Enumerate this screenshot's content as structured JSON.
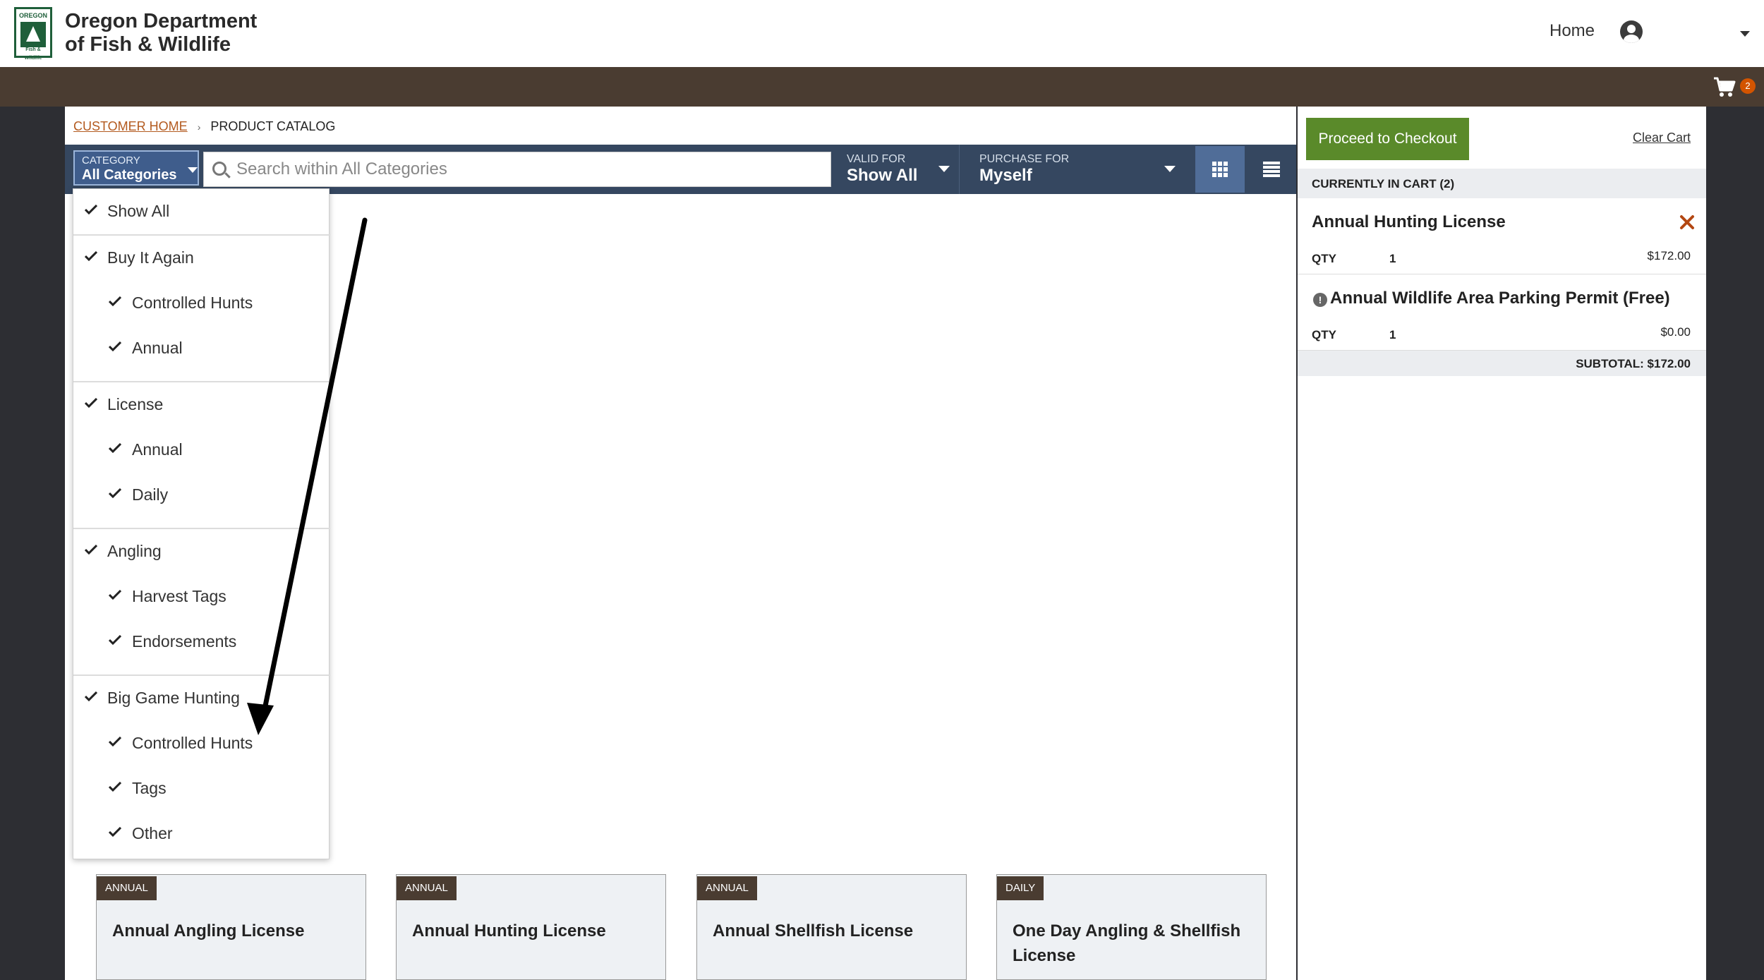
{
  "header": {
    "logo_top": "OREGON",
    "logo_bottom": "Fish & Wildlife",
    "org_line1": "Oregon Department",
    "org_line2": "of Fish & Wildlife",
    "home": "Home"
  },
  "cart_badge": "2",
  "breadcrumb": {
    "home": "CUSTOMER HOME",
    "current": "PRODUCT CATALOG"
  },
  "filters": {
    "category_label": "CATEGORY",
    "category_value": "All Categories",
    "search_placeholder": "Search within All Categories",
    "valid_label": "VALID FOR",
    "valid_value": "Show All",
    "purchase_label": "PURCHASE FOR",
    "purchase_value": "Myself"
  },
  "menu": {
    "items": [
      {
        "label": "Show All"
      },
      {
        "label": "Buy It Again"
      },
      {
        "label": "Controlled Hunts"
      },
      {
        "label": "Annual"
      },
      {
        "label": "License"
      },
      {
        "label": "Annual"
      },
      {
        "label": "Daily"
      },
      {
        "label": "Angling"
      },
      {
        "label": "Harvest Tags"
      },
      {
        "label": "Endorsements"
      },
      {
        "label": "Big Game Hunting"
      },
      {
        "label": "Controlled Hunts"
      },
      {
        "label": "Tags"
      },
      {
        "label": "Other"
      }
    ]
  },
  "products": [
    {
      "tag": "ANNUAL",
      "title": "Annual Angling License"
    },
    {
      "tag": "ANNUAL",
      "title": "Annual Hunting License"
    },
    {
      "tag": "ANNUAL",
      "title": "Annual Shellfish License"
    },
    {
      "tag": "DAILY",
      "title": "One Day Angling & Shellfish License"
    }
  ],
  "cart": {
    "checkout": "Proceed to Checkout",
    "clear": "Clear Cart",
    "header": "CURRENTLY IN CART (2)",
    "items": [
      {
        "title": "Annual Hunting License",
        "qty_label": "QTY",
        "qty": "1",
        "price": "$172.00"
      },
      {
        "title": "Annual Wildlife Area Parking Permit (Free)",
        "qty_label": "QTY",
        "qty": "1",
        "price": "$0.00"
      }
    ],
    "subtotal": "SUBTOTAL: $172.00"
  },
  "colors": {
    "brown": "#4a3c31",
    "navy": "#354760",
    "checkout_green": "#5a8a2a",
    "link_orange": "#b35a1f"
  }
}
